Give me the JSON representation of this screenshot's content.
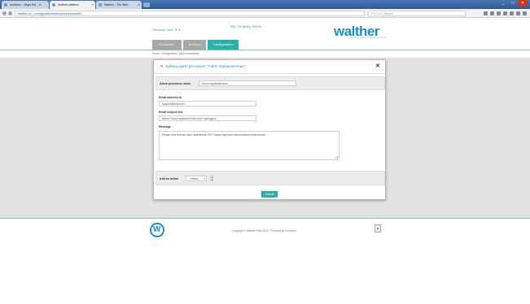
{
  "browser": {
    "tabs": [
      {
        "label": "ceriseInc - Virgin Sol... ✕"
      },
      {
        "label": "Walther platform"
      },
      {
        "label": "Walther - The Web"
      }
    ],
    "url": "walther.ch/…/configuration/alarm/procedures/edit/1",
    "search_placeholder": "P ▾ C ▾ G Search",
    "window_controls": [
      "_",
      "□",
      "✕"
    ]
  },
  "header": {
    "welcome": "Welcome User ▼ ▾",
    "company": "My company name",
    "logo": "walther",
    "logo_sub": "Walther Bolzenschweisstechnik"
  },
  "nav": {
    "tabs": [
      {
        "label": "Production"
      },
      {
        "label": "Analysis"
      },
      {
        "label": "Configuration"
      }
    ]
  },
  "breadcrumb": "Home / Configuration / Alarm procedures",
  "modal": {
    "title": "Editing alarm procedure \"Alarm nightwatchman\"",
    "name_label": "Alarm procedure name",
    "name_value": "Alarm nightwatchman",
    "email_label": "Email address to",
    "email_value": "support@mhy.com",
    "subject_label": "Email subject line",
    "subject_value": "Alarm! Some equipment has been unplugged",
    "message_label": "Message",
    "message_value": "Please note that we have detected an IPD Protect has been disconnected while armed.",
    "action_label": "Add an action",
    "action_select": "- Select -",
    "submit_label": "Submit"
  },
  "footer": {
    "copyright": "Copyright © Walther Plast 2014 · Powered by Dovetech",
    "logo_letter": "W"
  }
}
